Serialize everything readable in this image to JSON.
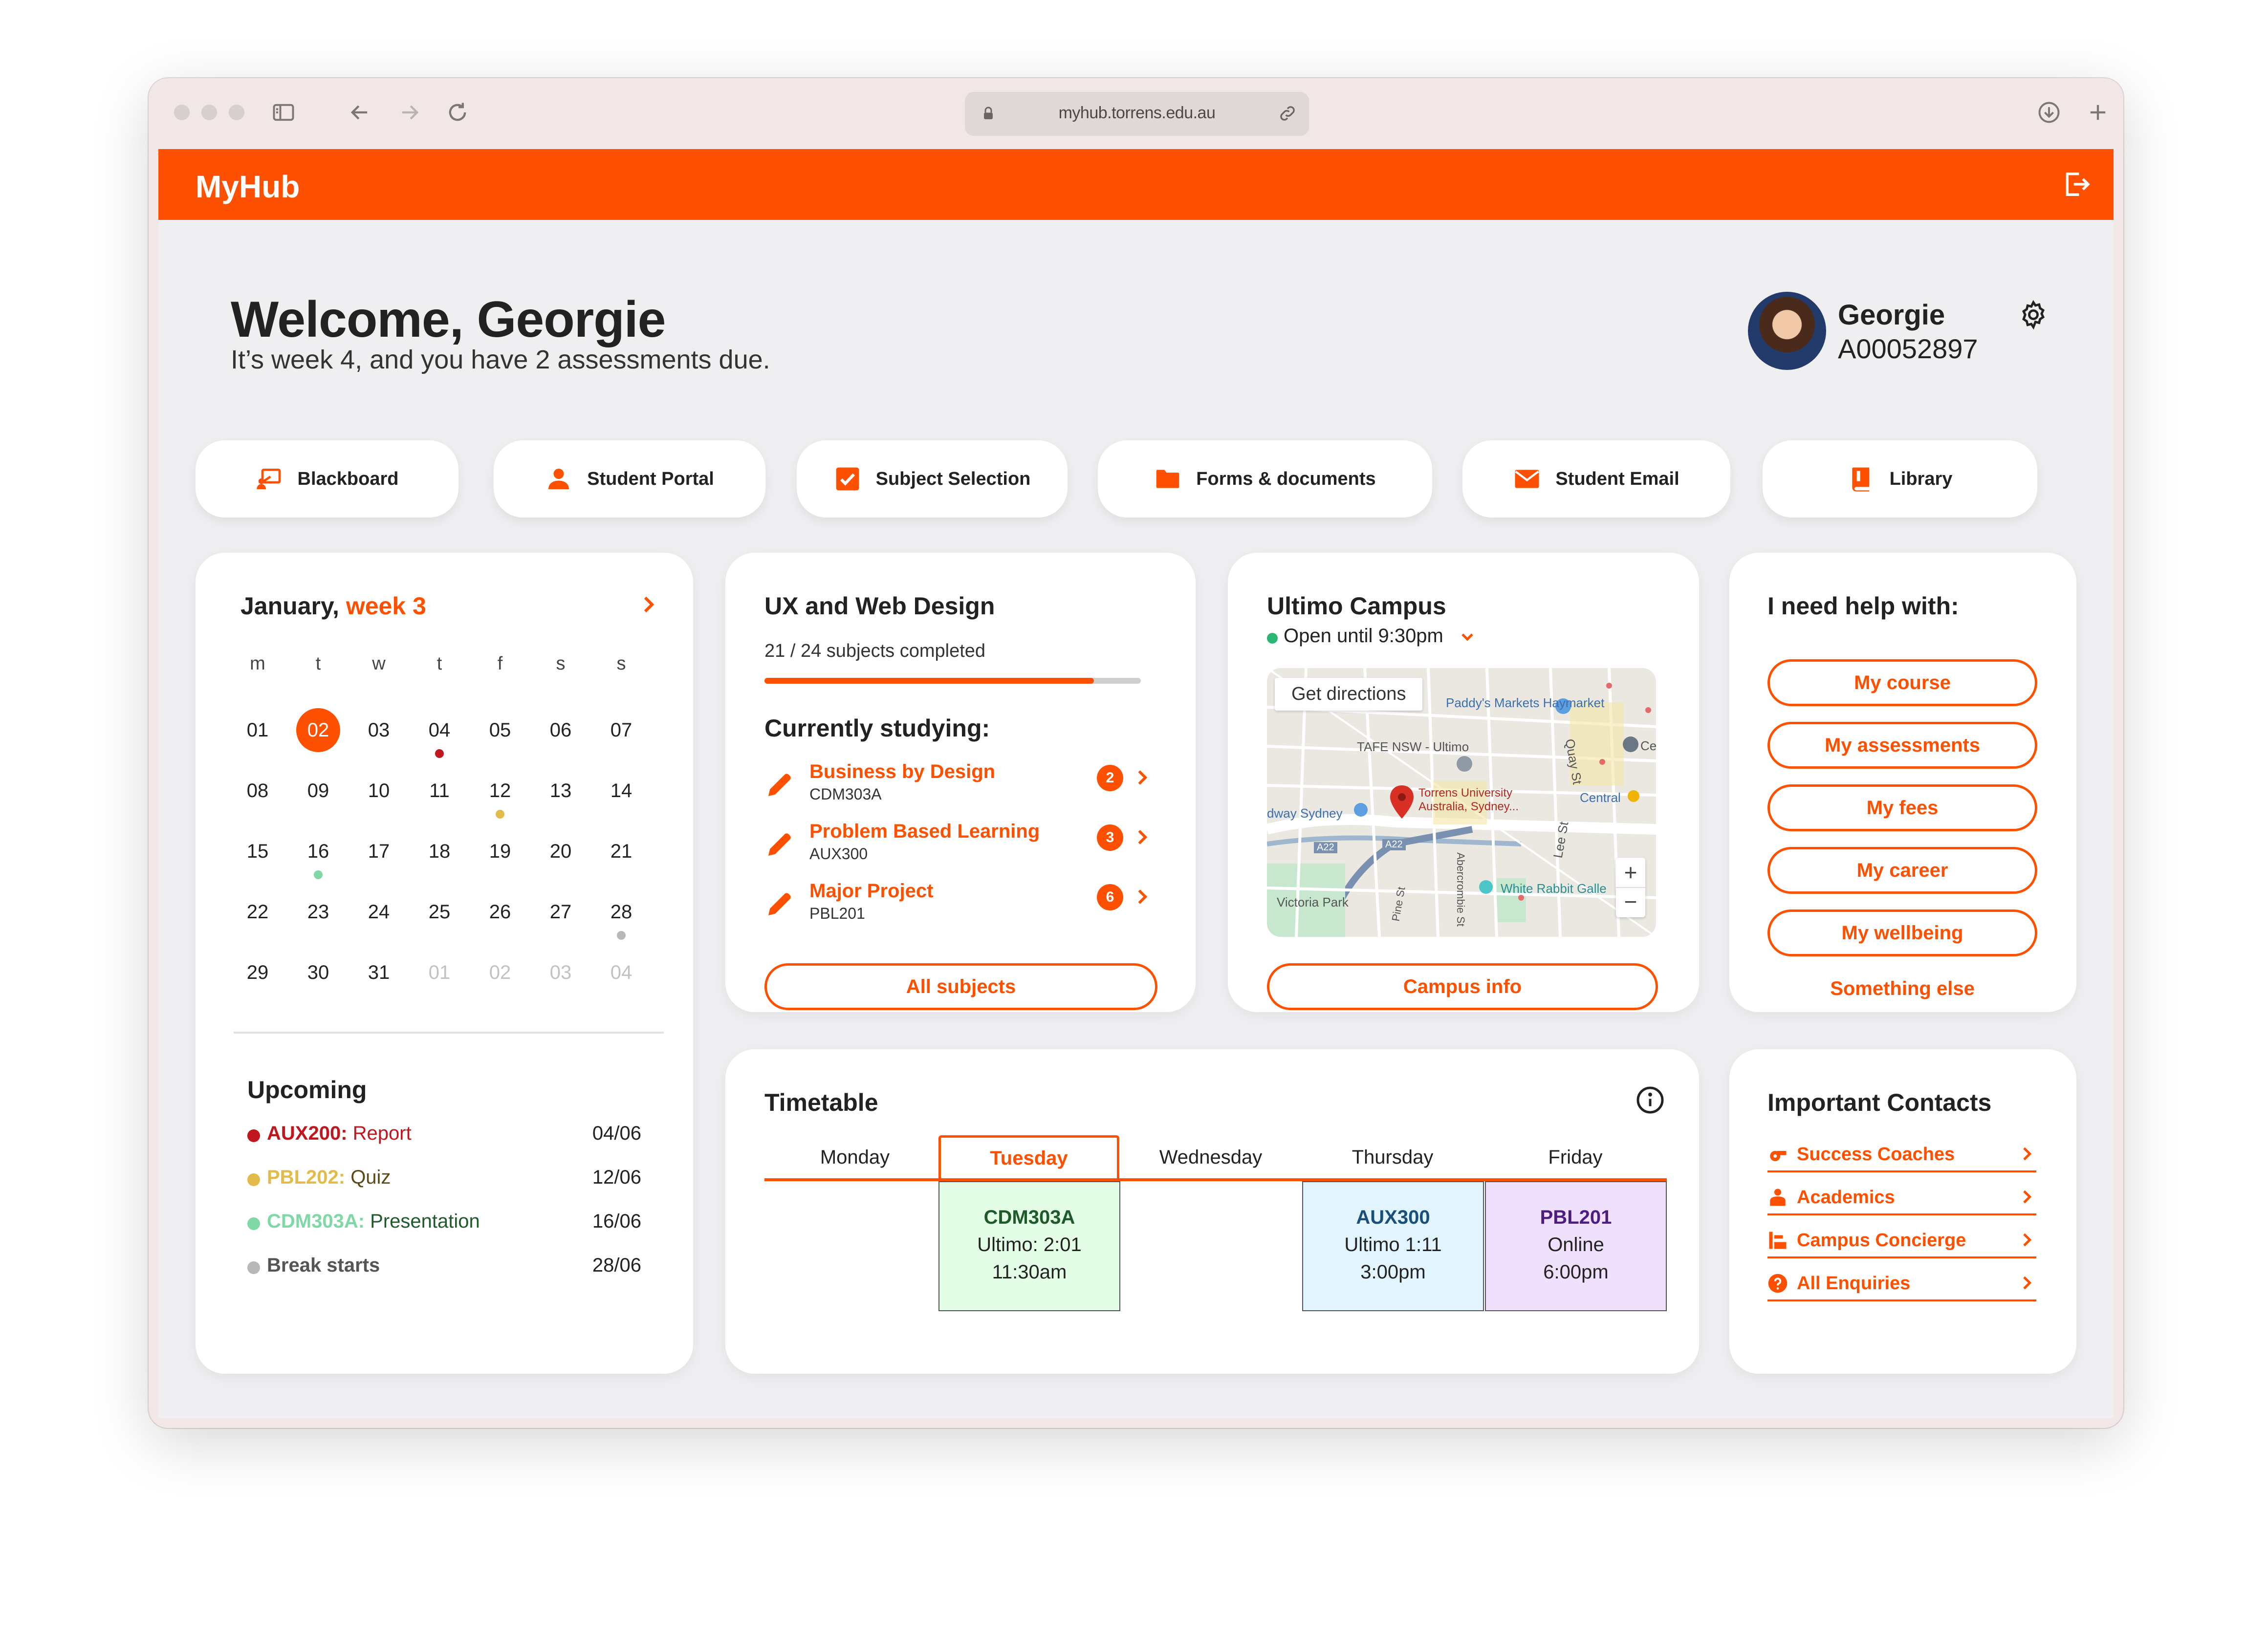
{
  "browser": {
    "url": "myhub.torrens.edu.au"
  },
  "app": {
    "brand": "MyHub"
  },
  "welcome": {
    "title": "Welcome, Georgie",
    "subtitle": "It’s week 4, and you have 2 assessments due."
  },
  "profile": {
    "name": "Georgie",
    "student_id": "A00052897"
  },
  "quick_links": [
    {
      "label": "Blackboard",
      "icon": "blackboard-icon"
    },
    {
      "label": "Student Portal",
      "icon": "user-icon"
    },
    {
      "label": "Subject Selection",
      "icon": "checkbox-icon"
    },
    {
      "label": "Forms & documents",
      "icon": "folder-icon"
    },
    {
      "label": "Student Email",
      "icon": "mail-icon"
    },
    {
      "label": "Library",
      "icon": "book-icon"
    }
  ],
  "calendar": {
    "month": "January,",
    "week": "week 3",
    "weekdays": [
      "m",
      "t",
      "w",
      "t",
      "f",
      "s",
      "s"
    ],
    "days": [
      "01",
      "02",
      "03",
      "04",
      "05",
      "06",
      "07",
      "08",
      "09",
      "10",
      "11",
      "12",
      "13",
      "14",
      "15",
      "16",
      "17",
      "18",
      "19",
      "20",
      "21",
      "22",
      "23",
      "24",
      "25",
      "26",
      "27",
      "28",
      "29",
      "30",
      "31",
      "01",
      "02",
      "03",
      "04"
    ],
    "today": "02",
    "colors": {
      "accent": "#fd5000",
      "red": "#c0161d",
      "yellow": "#e2bb4b",
      "green": "#7fd8a6",
      "grey": "#b8b8b8"
    }
  },
  "upcoming": {
    "title": "Upcoming",
    "items": [
      {
        "code": "AUX200:",
        "label": "Report",
        "date": "04/06",
        "color": "#c0161d"
      },
      {
        "code": "PBL202:",
        "label": "Quiz",
        "date": "12/06",
        "color": "#e2bb4b"
      },
      {
        "code": "CDM303A:",
        "label": "Presentation",
        "date": "16/06",
        "color": "#7fd8a6"
      },
      {
        "code": "",
        "label": "Break starts",
        "date": "28/06",
        "color": "#b8b8b8"
      }
    ]
  },
  "course": {
    "title": "UX and Web Design",
    "progress_label": "21 / 24 subjects completed",
    "progress_completed": 21,
    "progress_total": 24,
    "studying_title": "Currently studying:",
    "subjects": [
      {
        "name": "Business by Design",
        "code": "CDM303A",
        "count": "2"
      },
      {
        "name": "Problem Based Learning",
        "code": "AUX300",
        "count": "3"
      },
      {
        "name": "Major Project",
        "code": "PBL201",
        "count": "6"
      }
    ],
    "button": "All subjects"
  },
  "campus": {
    "title": "Ultimo Campus",
    "status": "Open until 9:30pm",
    "directions": "Get directions",
    "map_labels": [
      "Paddy's Markets Haymarket",
      "TAFE NSW - Ultimo",
      "Torrens University Australia, Sydney...",
      "Central",
      "dway Sydney",
      "Victoria Park",
      "White Rabbit Galle",
      "A22",
      "A22",
      "Quay St",
      "Lee St",
      "Abercrombie St",
      "Pine St",
      "Ce"
    ],
    "zoom_in": "+",
    "zoom_out": "−",
    "button": "Campus info"
  },
  "help": {
    "title": "I need help with:",
    "buttons": [
      "My course",
      "My assessments",
      "My fees",
      "My career",
      "My wellbeing"
    ],
    "other": "Something else"
  },
  "timetable": {
    "title": "Timetable",
    "days": [
      "Monday",
      "Tuesday",
      "Wednesday",
      "Thursday",
      "Friday"
    ],
    "active_day": "Tuesday",
    "classes": [
      {
        "day": "Tuesday",
        "code": "CDM303A",
        "room": "Ultimo: 2:01",
        "time": "11:30am",
        "bg": "#e3fde6",
        "code_color": "#1e5a2a"
      },
      {
        "day": "Thursday",
        "code": "AUX300",
        "room": "Ultimo 1:11",
        "time": "3:00pm",
        "bg": "#e2f4fd",
        "code_color": "#1a4f7a"
      },
      {
        "day": "Friday",
        "code": "PBL201",
        "room": "Online",
        "time": "6:00pm",
        "bg": "#efe0fc",
        "code_color": "#4d1d80"
      }
    ]
  },
  "contacts": {
    "title": "Important Contacts",
    "items": [
      {
        "label": "Success Coaches",
        "icon": "whistle-icon"
      },
      {
        "label": "Academics",
        "icon": "teacher-icon"
      },
      {
        "label": "Campus Concierge",
        "icon": "concierge-icon"
      },
      {
        "label": "All Enquiries",
        "icon": "question-icon"
      }
    ]
  },
  "colors": {
    "accent": "#fd5000",
    "page_bg": "#efeef0"
  }
}
